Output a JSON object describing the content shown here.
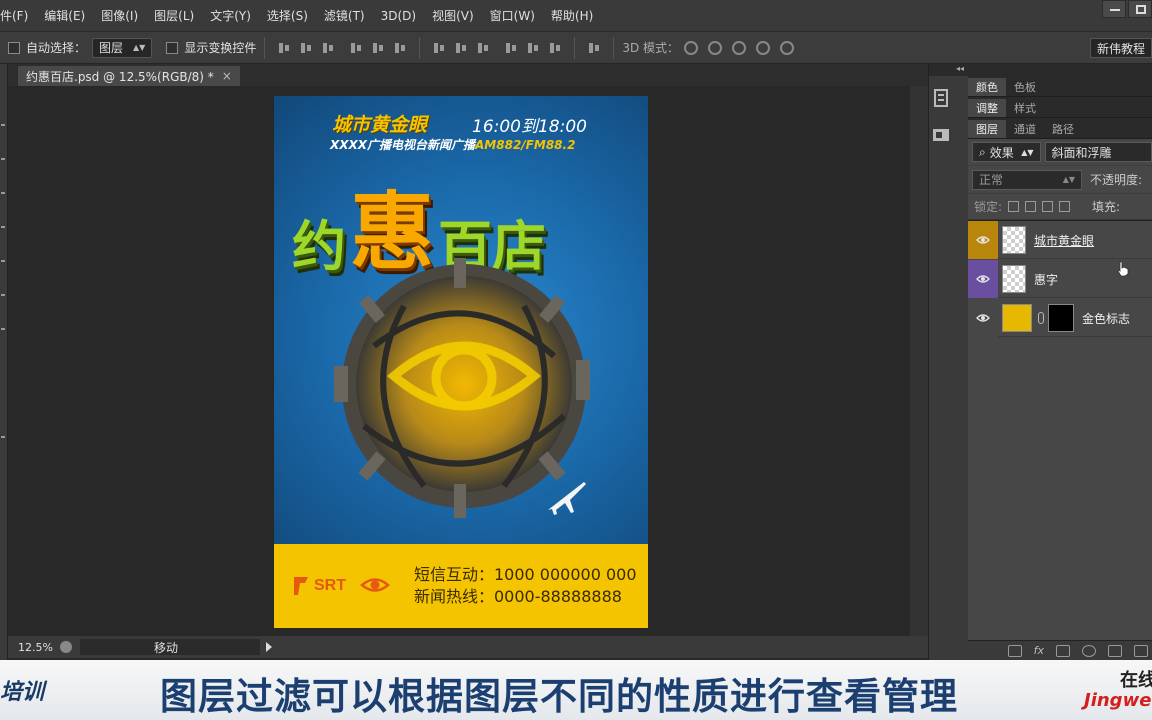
{
  "menu": [
    "件(F)",
    "编辑(E)",
    "图像(I)",
    "图层(L)",
    "文字(Y)",
    "选择(S)",
    "滤镜(T)",
    "3D(D)",
    "视图(V)",
    "窗口(W)",
    "帮助(H)"
  ],
  "options_bar": {
    "auto_select_label": "自动选择：",
    "auto_select_value": "图层",
    "show_transform_label": "显示变换控件",
    "mode3d_label": "3D 模式：",
    "workspace_button": "新伟教程"
  },
  "document": {
    "tab_title": "约惠百店.psd @ 12.5%(RGB/8) *",
    "close_glyph": "×"
  },
  "poster": {
    "headline": "城市黄金眼",
    "time": "16:00到18:00",
    "subline_prefix": "XXXX广播电视台新闻广播",
    "subline_freq": "AM882/FM88.2",
    "title_1": "约",
    "title_2": "惠",
    "title_3": "百店",
    "srt_text": "SRT",
    "sms_line": "短信互动：1000 000000 000",
    "hotline": "新闻热线：0000-88888888"
  },
  "status": {
    "zoom": "12.5%",
    "tool_text": "移动"
  },
  "panels": {
    "collapse_glyph": "◂◂",
    "row1_tabs": [
      "颜色",
      "色板"
    ],
    "row2_tabs": [
      "调整",
      "样式"
    ],
    "row3_tabs": [
      "图层",
      "通道",
      "路径"
    ],
    "filter_kind": "效果",
    "filter_effect": "斜面和浮雕",
    "blend_mode": "正常",
    "opacity_label": "不透明度:",
    "lock_label": "锁定:",
    "fill_label": "填充:"
  },
  "layers": [
    {
      "name": "城市黄金眼",
      "color": "#b8860b",
      "visible": true
    },
    {
      "name": "惠字",
      "color": "#6a4fa0",
      "visible": true
    },
    {
      "name": "金色标志",
      "color": "#474747",
      "visible": true
    }
  ],
  "caption": {
    "left": "培训",
    "text": "图层过滤可以根据图层不同的性质进行查看管理",
    "right_top": "在线",
    "right_bottom": "JingweiP"
  },
  "colors": {
    "accent_gold": "#f5c400",
    "title_green": "#9fd62a",
    "title_orange": "#f8a800",
    "caption_blue": "#1b3f70",
    "brand_red": "#d4201c"
  }
}
